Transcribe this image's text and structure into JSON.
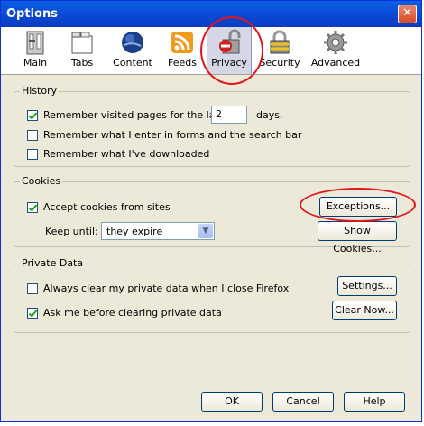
{
  "window": {
    "title": "Options",
    "close_glyph": "✕"
  },
  "tabs": [
    {
      "label": "Main",
      "icon": "main-icon"
    },
    {
      "label": "Tabs",
      "icon": "tabs-icon"
    },
    {
      "label": "Content",
      "icon": "content-icon"
    },
    {
      "label": "Feeds",
      "icon": "feeds-icon"
    },
    {
      "label": "Privacy",
      "icon": "privacy-icon",
      "selected": true
    },
    {
      "label": "Security",
      "icon": "security-icon"
    },
    {
      "label": "Advanced",
      "icon": "advanced-icon"
    }
  ],
  "history": {
    "legend": "History",
    "visited_label": "Remember visited pages for the last",
    "visited_days": "2",
    "days_label": "days.",
    "visited_checked": true,
    "forms_label": "Remember what I enter in forms and the search bar",
    "forms_checked": false,
    "downloads_label": "Remember what I've downloaded",
    "downloads_checked": false
  },
  "cookies": {
    "legend": "Cookies",
    "accept_label": "Accept cookies from sites",
    "accept_checked": true,
    "exceptions_button": "Exceptions...",
    "keep_until_label": "Keep until:",
    "keep_until_value": "they expire",
    "show_cookies_button": "Show Cookies..."
  },
  "private_data": {
    "legend": "Private Data",
    "always_clear_label": "Always clear my private data when I close Firefox",
    "always_clear_checked": false,
    "settings_button": "Settings...",
    "ask_label": "Ask me before clearing private data",
    "ask_checked": true,
    "clear_now_button": "Clear Now..."
  },
  "footer": {
    "ok": "OK",
    "cancel": "Cancel",
    "help": "Help"
  },
  "colors": {
    "annotation_circle": "#e0151d",
    "titlebar": "#0b48d3"
  }
}
